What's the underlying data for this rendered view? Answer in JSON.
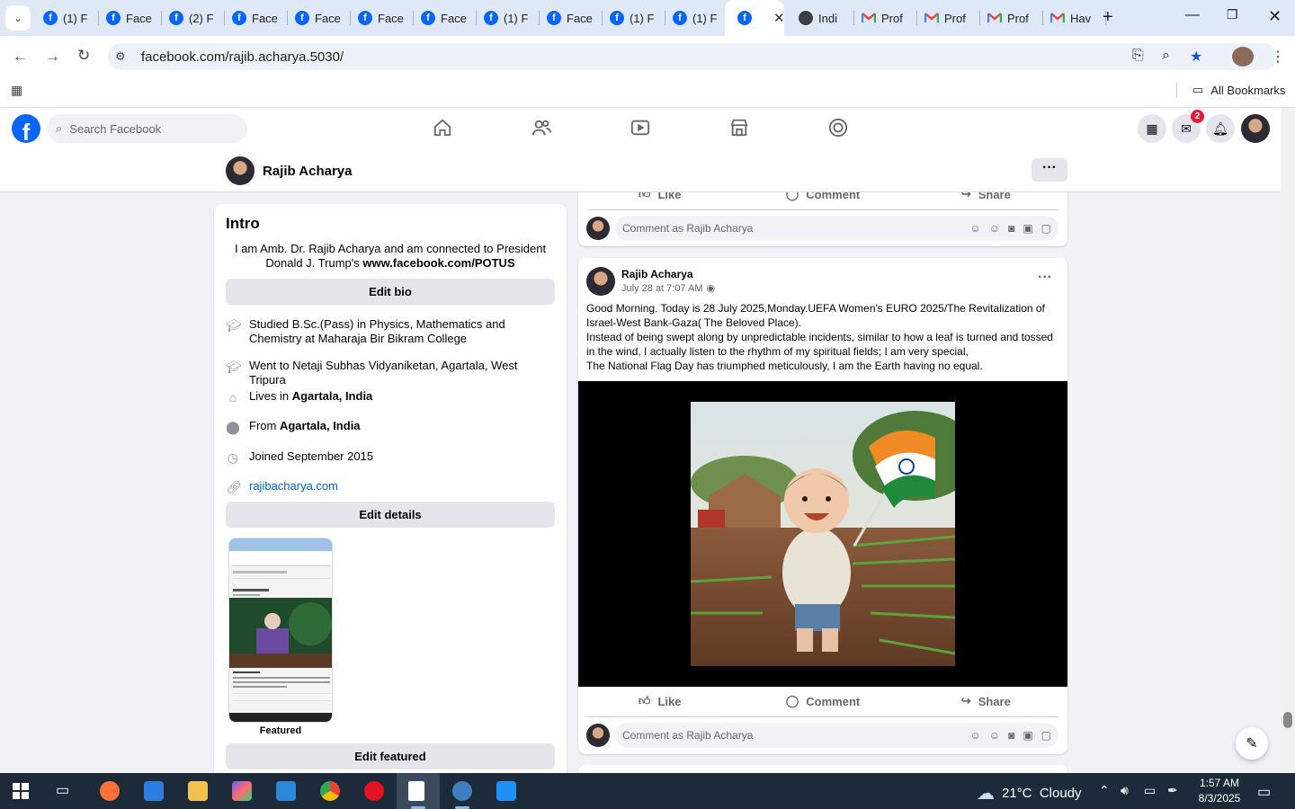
{
  "browser": {
    "tabs": [
      {
        "label": "(1) F",
        "icon": "facebook-icon"
      },
      {
        "label": "Face",
        "icon": "facebook-icon"
      },
      {
        "label": "(2) F",
        "icon": "facebook-icon"
      },
      {
        "label": "Face",
        "icon": "facebook-icon"
      },
      {
        "label": "Face",
        "icon": "facebook-icon"
      },
      {
        "label": "Face",
        "icon": "facebook-icon"
      },
      {
        "label": "Face",
        "icon": "facebook-icon"
      },
      {
        "label": "(1) F",
        "icon": "facebook-icon"
      },
      {
        "label": "Face",
        "icon": "facebook-icon"
      },
      {
        "label": "(1) F",
        "icon": "facebook-icon"
      },
      {
        "label": "(1) F",
        "icon": "facebook-icon"
      },
      {
        "label": "",
        "icon": "facebook-icon",
        "active": true
      },
      {
        "label": "Indi",
        "icon": "globe-icon"
      },
      {
        "label": "Prof",
        "icon": "gmail-icon"
      },
      {
        "label": "Prof",
        "icon": "gmail-icon"
      },
      {
        "label": "Prof",
        "icon": "gmail-icon"
      },
      {
        "label": "Hav",
        "icon": "gmail-icon"
      }
    ],
    "url": "facebook.com/rajib.acharya.5030/",
    "bookmarks_label": "All Bookmarks"
  },
  "facebook": {
    "search_placeholder": "Search Facebook",
    "messenger_badge": "2",
    "profile_name": "Rajib Acharya"
  },
  "intro": {
    "title": "Intro",
    "bio_line": "I am Amb. Dr. Rajib Acharya and am connected to President Donald J. Trump's ",
    "bio_link": "www.facebook.com/POTUS",
    "edit_bio": "Edit bio",
    "details": [
      {
        "icon": "graduation-cap-icon",
        "text": "Studied B.Sc.(Pass) in Physics, Mathematics and Chemistry at Maharaja Bir Bikram College"
      },
      {
        "icon": "graduation-cap-icon",
        "text": "Went to Netaji Subhas Vidyaniketan, Agartala, West Tripura"
      },
      {
        "icon": "home-icon",
        "prefix": "Lives in ",
        "bold": "Agartala, India"
      },
      {
        "icon": "location-pin-icon",
        "prefix": "From ",
        "bold": "Agartala, India"
      },
      {
        "icon": "clock-icon",
        "text": "Joined September 2015"
      },
      {
        "icon": "link-icon",
        "link": "rajibacharya.com"
      }
    ],
    "edit_details": "Edit details",
    "featured_label": "Featured",
    "edit_featured": "Edit featured"
  },
  "post_prev": {
    "like": "Like",
    "comment": "Comment",
    "share": "Share",
    "comment_placeholder": "Comment as Rajib Acharya"
  },
  "post": {
    "author": "Rajib Acharya",
    "time": "July 28 at 7:07 AM",
    "text_lines": [
      "Good Morning. Today is 28 July 2025,Monday.UEFA Women's EURO 2025/The Revitalization of Israel-West Bank-Gaza( The Beloved Place).",
      "Instead of being swept along by unpredictable incidents, similar to how a leaf is turned and tossed in the wind, I actually listen to the rhythm of my spiritual fields; I am very special,",
      "The National Flag Day has triumphed meticulously, I am the Earth having no equal."
    ],
    "like": "Like",
    "comment": "Comment",
    "share": "Share",
    "comment_placeholder": "Comment as Rajib Acharya"
  },
  "taskbar": {
    "weather": "21°C  Cloudy",
    "time": "1:57 AM",
    "date": "8/3/2025"
  },
  "colors": {
    "facebook_blue": "#0866ff",
    "link": "#0064d1",
    "badge_red": "#e41e3f",
    "taskbar": "#1c2a3a"
  }
}
